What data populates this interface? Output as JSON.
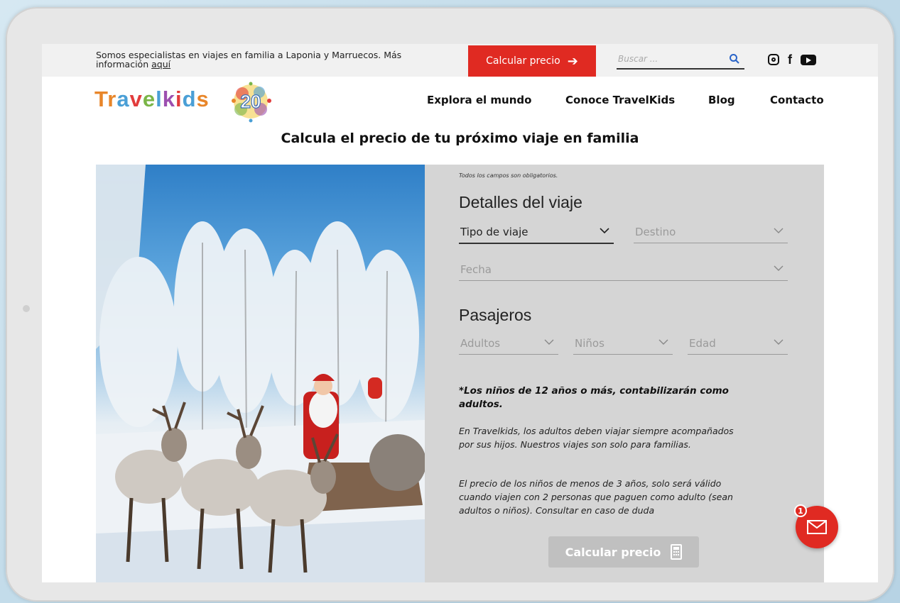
{
  "topbar": {
    "promo_text": "Somos especialistas en viajes en familia a Laponia y Marruecos. Más información ",
    "promo_link": "aquí",
    "cta_label": "Calcular precio",
    "search_placeholder": "Buscar ..."
  },
  "header": {
    "logo_letters": [
      "T",
      "r",
      "a",
      "v",
      "e",
      "l",
      "k",
      "i",
      "d",
      "s"
    ],
    "badge_text": "20",
    "nav": [
      "Explora el mundo",
      "Conoce TravelKids",
      "Blog",
      "Contacto"
    ]
  },
  "page": {
    "title": "Calcula el precio de tu próximo viaje en familia"
  },
  "form": {
    "required_note": "Todos los campos son obligatorios.",
    "trip_section": "Detalles del viaje",
    "trip_type": "Tipo de viaje",
    "destination": "Destino",
    "date": "Fecha",
    "passengers_section": "Pasajeros",
    "adults": "Adultos",
    "children": "Niños",
    "age": "Edad",
    "note_bold": "*Los niños de 12 años o más, contabilizarán como adultos.",
    "note_1": "En Travelkids, los adultos deben viajar siempre acompañados por sus hijos. Nuestros viajes son solo para familias.",
    "note_2": "El precio de los niños de menos de 3 años, solo será válido cuando viajen con 2 personas que paguen como adulto (sean adultos o niños). Consultar en caso de duda",
    "submit_label": "Calcular precio"
  },
  "chat": {
    "badge_count": "1"
  },
  "colors": {
    "brand_red": "#e02a22",
    "panel_gray": "#d5d5d5"
  }
}
